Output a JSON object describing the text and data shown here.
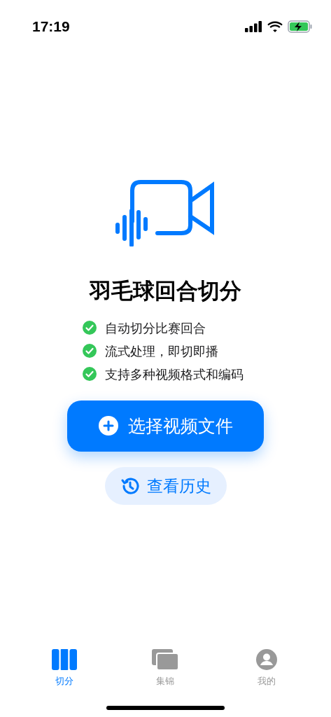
{
  "status_bar": {
    "time": "17:19"
  },
  "title": "羽毛球回合切分",
  "features": [
    {
      "text": "自动切分比赛回合",
      "checked": true
    },
    {
      "text": "流式处理，即切即播",
      "checked": true
    },
    {
      "text": "支持多种视频格式和编码",
      "checked": true
    }
  ],
  "primary_button": {
    "label": "选择视频文件"
  },
  "secondary_button": {
    "label": "查看历史"
  },
  "tabs": [
    {
      "label": "切分",
      "kind": "split",
      "selected": true
    },
    {
      "label": "集锦",
      "kind": "gallery",
      "selected": false
    },
    {
      "label": "我的",
      "kind": "profile",
      "selected": false
    }
  ]
}
